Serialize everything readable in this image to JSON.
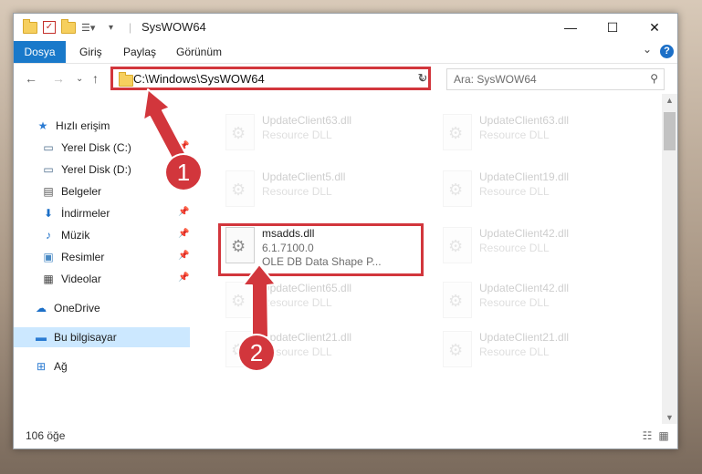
{
  "window": {
    "title": "SysWOW64",
    "controls": {
      "minimize": "—",
      "maximize": "☐",
      "close": "✕"
    }
  },
  "ribbon": {
    "tabs": [
      {
        "label": "Dosya",
        "active": true
      },
      {
        "label": "Giriş"
      },
      {
        "label": "Paylaş"
      },
      {
        "label": "Görünüm"
      }
    ],
    "help": "?"
  },
  "address": {
    "path": "C:\\Windows\\SysWOW64",
    "search_placeholder": "Ara: SysWOW64"
  },
  "nav_pane": {
    "items": [
      {
        "label": "Hızlı erişim",
        "icon": "star-icon",
        "pinned": false
      },
      {
        "label": "Yerel Disk (C:)",
        "icon": "drive-icon",
        "pinned": true
      },
      {
        "label": "Yerel Disk (D:)",
        "icon": "drive-icon",
        "pinned": false
      },
      {
        "label": "Belgeler",
        "icon": "document-icon",
        "pinned": false
      },
      {
        "label": "İndirmeler",
        "icon": "download-icon",
        "pinned": true
      },
      {
        "label": "Müzik",
        "icon": "music-icon",
        "pinned": true
      },
      {
        "label": "Resimler",
        "icon": "pictures-icon",
        "pinned": true
      },
      {
        "label": "Videolar",
        "icon": "video-icon",
        "pinned": true
      },
      {
        "label": "OneDrive",
        "icon": "cloud-icon",
        "pinned": false
      },
      {
        "label": "Bu bilgisayar",
        "icon": "computer-icon",
        "pinned": false,
        "selected": true
      },
      {
        "label": "Ağ",
        "icon": "network-icon",
        "pinned": false
      }
    ]
  },
  "files": {
    "left": [
      {
        "name": "UpdateClient63.dll",
        "desc": "Resource DLL"
      },
      {
        "name": "UpdateClient5.dll",
        "desc": "Resource DLL"
      },
      {
        "name": "msadds.dll",
        "version": "6.1.7100.0",
        "desc": "OLE DB Data Shape P..."
      },
      {
        "name": "UpdateClient65.dll",
        "desc": "Resource DLL"
      },
      {
        "name": "UpdateClient21.dll",
        "desc": "Resource DLL"
      }
    ],
    "right": [
      {
        "name": "UpdateClient63.dll",
        "desc": "Resource DLL"
      },
      {
        "name": "UpdateClient19.dll",
        "desc": "Resource DLL"
      },
      {
        "name": "UpdateClient42.dll",
        "desc": "Resource DLL"
      },
      {
        "name": "UpdateClient42.dll",
        "desc": "Resource DLL"
      },
      {
        "name": "UpdateClient21.dll",
        "desc": "Resource DLL"
      }
    ]
  },
  "status": {
    "count": "106 öğe"
  },
  "annotations": {
    "step1": "1",
    "step2": "2",
    "color": "#d2363c"
  }
}
